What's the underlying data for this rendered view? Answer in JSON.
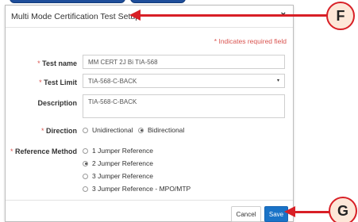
{
  "dialog": {
    "title": "Multi Mode Certification Test Setup",
    "close_label": "×",
    "required_note": "* Indicates required field"
  },
  "form": {
    "test_name": {
      "asterisk": "* ",
      "label": "Test name",
      "value": "MM CERT 2J Bi TIA-568"
    },
    "test_limit": {
      "asterisk": "* ",
      "label": "Test Limit",
      "value": "TIA-568-C-BACK",
      "caret": "▾"
    },
    "description": {
      "label": "Description",
      "value": "TIA-568-C-BACK"
    },
    "direction": {
      "asterisk": "* ",
      "label": "Direction",
      "options": [
        {
          "label": "Unidirectional",
          "checked": false
        },
        {
          "label": "Bidirectional",
          "checked": true
        }
      ]
    },
    "reference_method": {
      "asterisk": "* ",
      "label": "Reference Method",
      "options": [
        {
          "label": "1 Jumper Reference",
          "checked": false
        },
        {
          "label": "2 Jumper Reference",
          "checked": true
        },
        {
          "label": "3 Jumper Reference",
          "checked": false
        },
        {
          "label": "3 Jumper Reference - MPO/MTP",
          "checked": false
        }
      ]
    }
  },
  "buttons": {
    "cancel_label": "Cancel",
    "save_label": "Save"
  },
  "callouts": {
    "f_letter": "F",
    "g_letter": "G"
  },
  "colors": {
    "accent_blue": "#1a73c7",
    "required_red": "#d9534f",
    "callout_red": "#d81f26",
    "callout_fill": "#fde7d8"
  }
}
